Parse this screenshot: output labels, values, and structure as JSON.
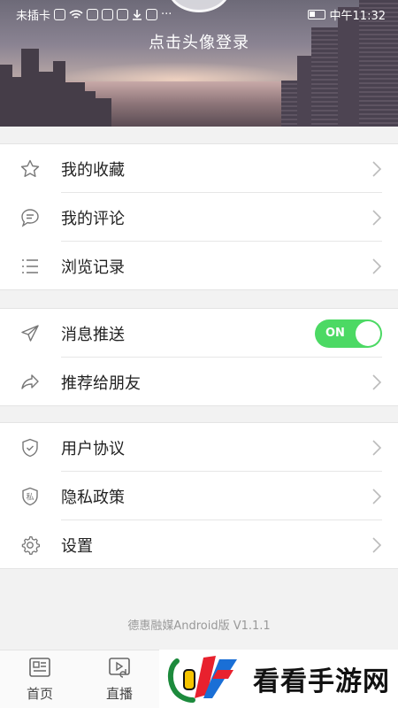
{
  "status_bar": {
    "carrier": "未插卡",
    "time": "中午11:32",
    "more": "···"
  },
  "header": {
    "login_text": "点击头像登录"
  },
  "menu_groups": [
    {
      "items": [
        {
          "label": "我的收藏",
          "icon": "star-icon"
        },
        {
          "label": "我的评论",
          "icon": "comment-icon"
        },
        {
          "label": "浏览记录",
          "icon": "list-icon"
        }
      ]
    },
    {
      "items": [
        {
          "label": "消息推送",
          "icon": "send-icon",
          "toggle": "ON"
        },
        {
          "label": "推荐给朋友",
          "icon": "share-icon"
        }
      ]
    },
    {
      "items": [
        {
          "label": "用户协议",
          "icon": "shield-check-icon"
        },
        {
          "label": "隐私政策",
          "icon": "privacy-shield-icon",
          "icon_text": "私"
        },
        {
          "label": "设置",
          "icon": "gear-icon"
        }
      ]
    }
  ],
  "version_text": "德惠融媒Android版 V1.1.1",
  "tabs": [
    {
      "label": "首页",
      "icon": "news-icon"
    },
    {
      "label": "直播",
      "icon": "video-icon"
    }
  ],
  "watermark": {
    "text": "看看手游网"
  },
  "colors": {
    "toggle_on": "#4cd964",
    "background": "#f2f2f2"
  }
}
